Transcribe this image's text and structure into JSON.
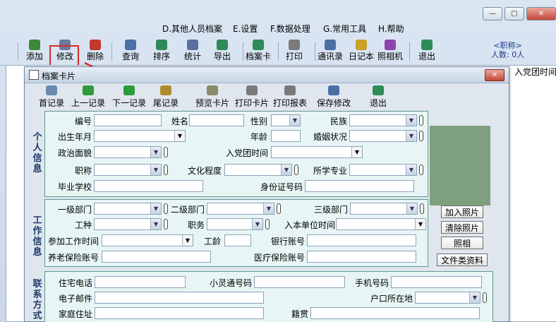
{
  "window": {
    "title": "",
    "controls": {
      "minimize": "—",
      "maximize": "▢",
      "close": "✕"
    }
  },
  "menu": [
    "D.其他人员档案",
    "E.设置",
    "F.数据处理",
    "G.常用工具",
    "H.帮助"
  ],
  "toolbar": [
    {
      "label": "添加",
      "icon": "add-icon",
      "color": "#3a8a3a"
    },
    {
      "label": "修改",
      "icon": "edit-icon",
      "color": "#6a7a9a"
    },
    {
      "label": "删除",
      "icon": "delete-icon",
      "color": "#c0392b"
    },
    {
      "label": "查询",
      "icon": "search-icon",
      "color": "#4a6fa5"
    },
    {
      "label": "排序",
      "icon": "sort-icon",
      "color": "#2e8b57"
    },
    {
      "label": "统计",
      "icon": "stats-icon",
      "color": "#5a6fa0"
    },
    {
      "label": "导出",
      "icon": "export-icon",
      "color": "#2e8b57"
    },
    {
      "label": "档案卡",
      "icon": "card-icon",
      "color": "#2e8b57"
    },
    {
      "label": "打印",
      "icon": "print-icon",
      "color": "#7a7a7a"
    },
    {
      "label": "通讯录",
      "icon": "addressbook-icon",
      "color": "#4a6fa5"
    },
    {
      "label": "日记本",
      "icon": "diary-icon",
      "color": "#c9a227"
    },
    {
      "label": "照相机",
      "icon": "camera-icon",
      "color": "#8e44ad"
    },
    {
      "label": "退出",
      "icon": "exit-icon",
      "color": "#2e8b57"
    }
  ],
  "status": {
    "title": "<职称>",
    "count": "人数: 0人"
  },
  "list_header": {
    "col": "入党团时间"
  },
  "dialog": {
    "title": "档案卡片",
    "close": "✕",
    "toolbar": [
      {
        "label": "首记录",
        "icon": "first-record-icon",
        "color": "#6a8ab0"
      },
      {
        "label": "上一记录",
        "icon": "prev-record-icon",
        "color": "#2e9a3a"
      },
      {
        "label": "下一记录",
        "icon": "next-record-icon",
        "color": "#2e9a3a"
      },
      {
        "label": "尾记录",
        "icon": "last-record-icon",
        "color": "#b08a2a"
      },
      {
        "label": "预览卡片",
        "icon": "preview-icon",
        "color": "#8a8a6a"
      },
      {
        "label": "打印卡片",
        "icon": "print-card-icon",
        "color": "#7a7a7a"
      },
      {
        "label": "打印报表",
        "icon": "print-report-icon",
        "color": "#7a7a7a"
      },
      {
        "label": "保存修改",
        "icon": "save-icon",
        "color": "#4a6fa5"
      },
      {
        "label": "退出",
        "icon": "exit-icon",
        "color": "#2e8b57"
      }
    ],
    "groups": {
      "personal": "个人信息",
      "work": "工作信息",
      "contact": "联系方式"
    },
    "fields": {
      "id": "编号",
      "name": "姓名",
      "gender": "性别",
      "ethnicity": "民族",
      "birth": "出生年月",
      "age": "年龄",
      "marital": "婚姻状况",
      "political": "政治面貌",
      "party_date": "入党团时间",
      "title": "职称",
      "education": "文化程度",
      "major": "所学专业",
      "school": "毕业学校",
      "id_number": "身份证号码",
      "dept1": "一级部门",
      "dept2": "二级部门",
      "dept3": "三级部门",
      "job_type": "工种",
      "position": "职务",
      "join_date": "入本单位时间",
      "work_start": "参加工作时间",
      "seniority": "工龄",
      "bank": "银行账号",
      "pension": "养老保险账号",
      "medical": "医疗保险账号",
      "home_phone": "住宅电话",
      "phs": "小灵通号码",
      "mobile": "手机号码",
      "email": "电子邮件",
      "hukou": "户口所在地",
      "address": "家庭住址",
      "native": "籍贯"
    },
    "photo_buttons": [
      "加入照片",
      "清除照片",
      "照相",
      "文件类资料"
    ]
  },
  "colors": {
    "highlight": "#d92b2b",
    "group_border": "#5f9790",
    "photo": "#7fa07f"
  }
}
